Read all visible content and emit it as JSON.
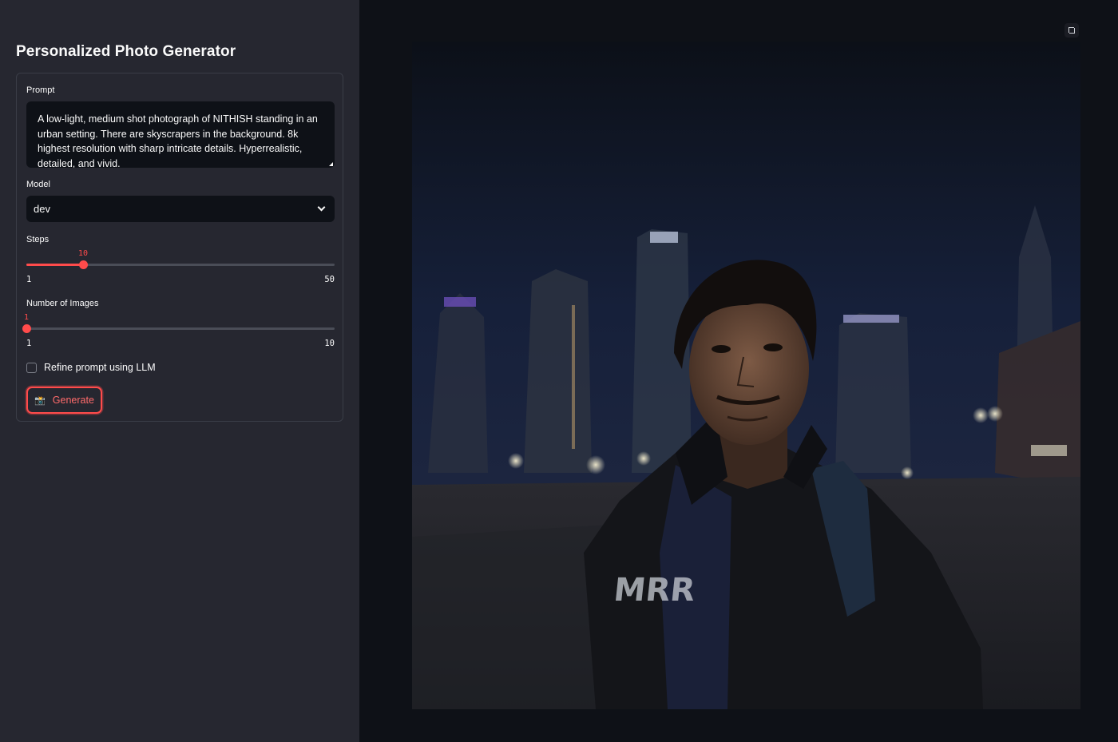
{
  "sidebar": {
    "title": "Personalized Photo Generator",
    "prompt": {
      "label": "Prompt",
      "value": "A low-light, medium shot photograph of NITHISH standing in an urban setting. There are skyscrapers in the background. 8k highest resolution with sharp intricate details. Hyperrealistic, detailed, and vivid."
    },
    "model": {
      "label": "Model",
      "selected": "dev"
    },
    "steps": {
      "label": "Steps",
      "value": "10",
      "min": "1",
      "max": "50"
    },
    "num_images": {
      "label": "Number of Images",
      "value": "1",
      "min": "1",
      "max": "10"
    },
    "refine": {
      "label": "Refine prompt using LLM",
      "checked": false
    },
    "generate": {
      "label": "Generate",
      "icon": "camera-flash-icon"
    }
  },
  "main": {
    "image": {
      "description_icon": "generated-photo"
    },
    "fullscreen_icon": "fullscreen-icon"
  },
  "colors": {
    "sidebar_bg": "#262730",
    "main_bg": "#0e1117",
    "accent": "#ff4b4b",
    "text": "#fafafa"
  }
}
